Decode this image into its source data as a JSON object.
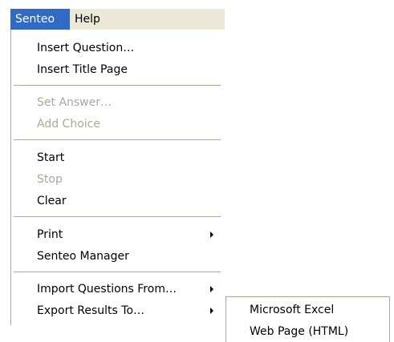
{
  "menubar": {
    "items": [
      {
        "label": "Senteo",
        "active": true
      },
      {
        "label": "Help",
        "active": false
      }
    ]
  },
  "menu": {
    "insert_question": "Insert Question…",
    "insert_title_page": "Insert Title Page",
    "set_answer": "Set Answer…",
    "add_choice": "Add Choice",
    "start": "Start",
    "stop": "Stop",
    "clear": "Clear",
    "print": "Print",
    "senteo_manager": "Senteo Manager",
    "import_questions": "Import Questions From…",
    "export_results": "Export Results To…"
  },
  "submenu": {
    "items": [
      {
        "label": "Microsoft Excel"
      },
      {
        "label": "Web Page (HTML)"
      }
    ]
  },
  "colors": {
    "highlight": "#316ac5",
    "disabled_text": "#aca899",
    "menubar_bg": "#ece9d8"
  }
}
